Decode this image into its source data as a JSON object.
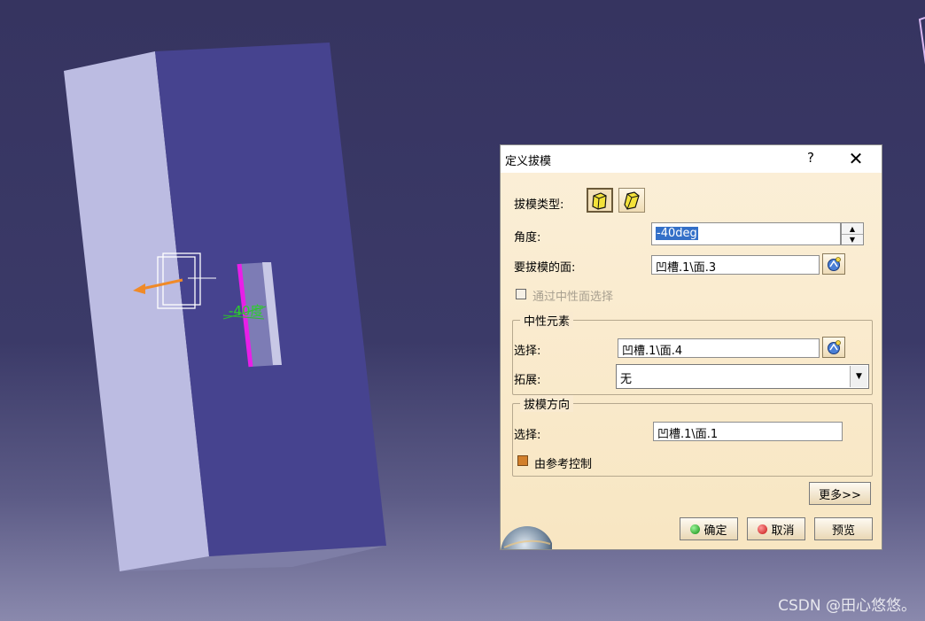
{
  "watermark": "CSDN @田心悠悠。",
  "dialog": {
    "title": "定义拔模",
    "help_label": "?",
    "close_label": "✕",
    "draft_type_label": "拔模类型:",
    "angle_label": "角度:",
    "angle_value": "-40deg",
    "faces_label": "要拔模的面:",
    "faces_value": "凹槽.1\\面.3",
    "neutral_selection_checkbox_label": "通过中性面选择",
    "neutral_group_title": "中性元素",
    "neutral_select_label": "选择:",
    "neutral_select_value": "凹槽.1\\面.4",
    "propagation_label": "拓展:",
    "propagation_value": "无",
    "direction_group_title": "拔模方向",
    "direction_select_label": "选择:",
    "direction_select_value": "凹槽.1\\面.1",
    "reference_control_label": "由参考控制",
    "reference_control_checked": true,
    "more_button": "更多>>",
    "ok_button": "确定",
    "cancel_button": "取消",
    "preview_button": "预览"
  },
  "viewport": {
    "angle_annotation": "-40度"
  }
}
